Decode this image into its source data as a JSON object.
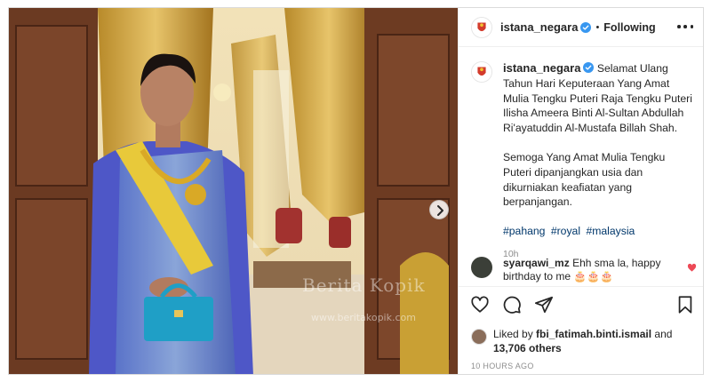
{
  "post": {
    "username": "istana_negara",
    "separator": "•",
    "follow_status": "Following",
    "verified": true,
    "caption": {
      "paragraph1": "Selamat Ulang Tahun Hari Keputeraan Yang Amat Mulia Tengku Puteri Raja Tengku Puteri Ilisha Ameera Binti Al-Sultan Abdullah Ri'ayatuddin Al-Mustafa Billah Shah.",
      "paragraph2": "Semoga Yang Amat Mulia Tengku Puteri dipanjangkan usia dan dikurniakan keafiatan yang berpanjangan.",
      "hashtags": [
        "#pahang",
        "#royal",
        "#malaysia"
      ]
    },
    "caption_time": "10h",
    "comment": {
      "username": "syarqawi_mz",
      "text": "Ehh sma la, happy birthday to me 🎂🎂🎂"
    },
    "likes": {
      "prefix": "Liked by",
      "first_liker": "fbi_fatimah.binti.ismail",
      "and": "and",
      "others": "13,706 others"
    },
    "post_time": "10 HOURS AGO"
  },
  "photo": {
    "watermark_text": "Berita Kopik",
    "watermark_url": "www.beritakopik.com"
  },
  "colors": {
    "verified_blue": "#3897f0",
    "link_blue": "#00376b",
    "like_red": "#ed4956",
    "muted": "#8e8e8e"
  },
  "icons": [
    "verified-badge-icon",
    "more-options-icon",
    "heart-icon",
    "comment-icon",
    "share-icon",
    "bookmark-icon",
    "chevron-right-icon"
  ]
}
